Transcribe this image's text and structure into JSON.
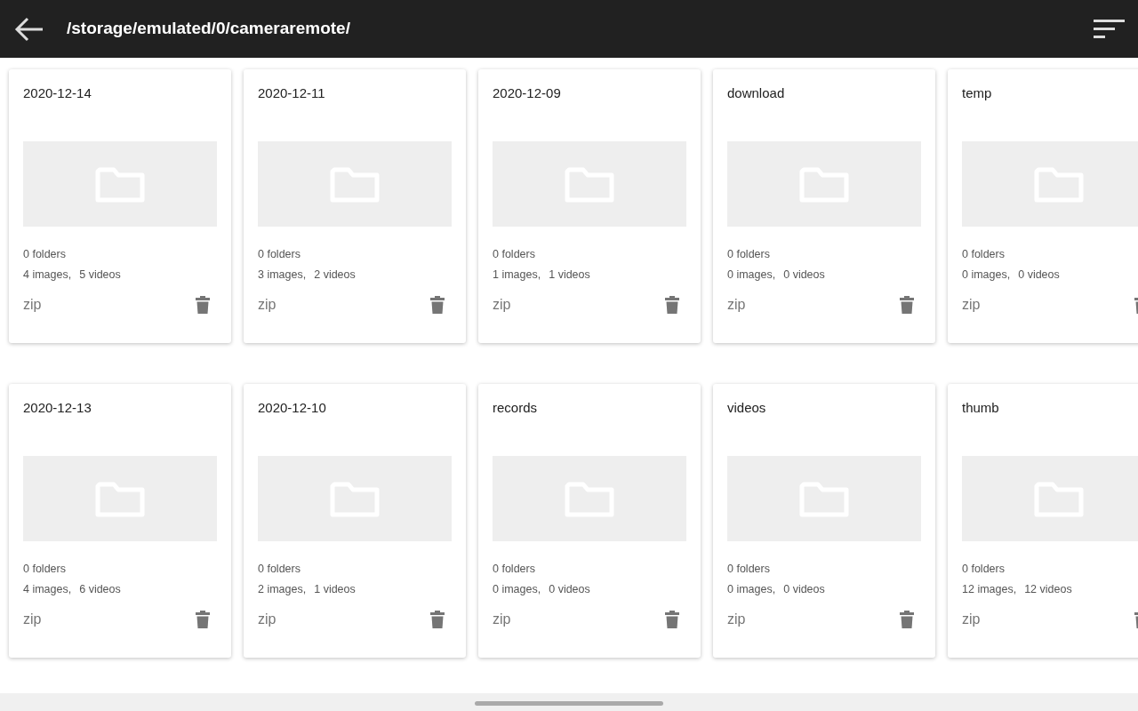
{
  "toolbar": {
    "path": "/storage/emulated/0/cameraremote/"
  },
  "folders": [
    {
      "name": "2020-12-14",
      "folders": "0 folders",
      "images": "4 images,",
      "videos": "5 videos",
      "action": "zip"
    },
    {
      "name": "2020-12-11",
      "folders": "0 folders",
      "images": "3 images,",
      "videos": "2 videos",
      "action": "zip"
    },
    {
      "name": "2020-12-09",
      "folders": "0 folders",
      "images": "1 images,",
      "videos": "1 videos",
      "action": "zip"
    },
    {
      "name": "download",
      "folders": "0 folders",
      "images": "0 images,",
      "videos": "0 videos",
      "action": "zip"
    },
    {
      "name": "temp",
      "folders": "0 folders",
      "images": "0 images,",
      "videos": "0 videos",
      "action": "zip"
    },
    {
      "name": "2020-12-13",
      "folders": "0 folders",
      "images": "4 images,",
      "videos": "6 videos",
      "action": "zip"
    },
    {
      "name": "2020-12-10",
      "folders": "0 folders",
      "images": "2 images,",
      "videos": "1 videos",
      "action": "zip"
    },
    {
      "name": "records",
      "folders": "0 folders",
      "images": "0 images,",
      "videos": "0 videos",
      "action": "zip"
    },
    {
      "name": "videos",
      "folders": "0 folders",
      "images": "0 images,",
      "videos": "0 videos",
      "action": "zip"
    },
    {
      "name": "thumb",
      "folders": "0 folders",
      "images": "12 images,",
      "videos": "12 videos",
      "action": "zip"
    }
  ]
}
